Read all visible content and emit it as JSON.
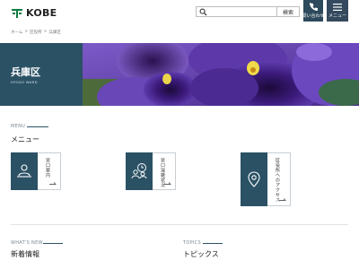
{
  "header": {
    "logo_text": "KOBE",
    "search_placeholder": "",
    "search_button": "検索",
    "contact_label": "問い合わせ",
    "menu_label": "メニュー"
  },
  "breadcrumb": [
    "ホーム",
    "区役所",
    "兵庫区"
  ],
  "hero": {
    "title": "兵庫区",
    "subtitle": "HYOGO WARD"
  },
  "menu_section": {
    "label_en": "MENU",
    "label_jp": "メニュー",
    "cards": [
      {
        "label": "窓口案内",
        "icon": "person-desk-icon"
      },
      {
        "label": "窓口混雑状況",
        "icon": "people-clock-icon"
      },
      {
        "label": "区役所へのアクセス",
        "icon": "map-pin-icon"
      }
    ]
  },
  "news_section": {
    "label_en": "WHAT'S NEW",
    "label_jp": "新着情報"
  },
  "topics_section": {
    "label_en": "TOPICS",
    "label_jp": "トピックス"
  },
  "colors": {
    "accent": "#2b5165",
    "header_button": "#2d4a5c",
    "text": "#222222"
  }
}
